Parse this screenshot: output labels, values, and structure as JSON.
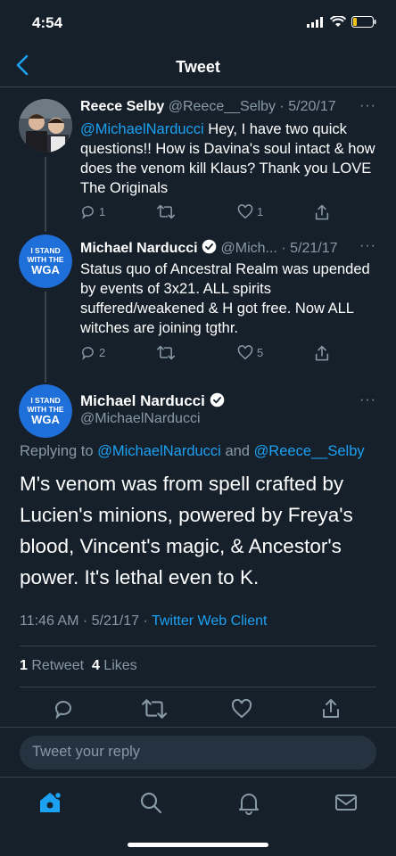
{
  "status_bar": {
    "time": "4:54"
  },
  "nav": {
    "title": "Tweet"
  },
  "tweets": [
    {
      "name": "Reece Selby",
      "handle": "@Reece__Selby",
      "date": "· 5/20/17",
      "mention": "@MichaelNarducci",
      "text": " Hey, I have two quick questions!! How is Davina's soul intact & how does the venom kill Klaus? Thank you LOVE The Originals",
      "reply_count": "1",
      "retweet_count": "",
      "like_count": "1"
    },
    {
      "name": "Michael Narducci",
      "handle": "@Mich...",
      "date": "· 5/21/17",
      "text": "Status quo of Ancestral Realm was upended by events of 3x21. ALL spirits suffered/weakened & H got free. Now ALL witches are joining tgthr.",
      "reply_count": "2",
      "retweet_count": "",
      "like_count": "5"
    }
  ],
  "avatar_badge": {
    "line1": "I STAND",
    "line2": "WITH THE",
    "line3": "WGA"
  },
  "main_tweet": {
    "name": "Michael Narducci",
    "handle": "@MichaelNarducci",
    "replying_prefix": "Replying to ",
    "replying_user1": "@MichaelNarducci",
    "replying_and": " and ",
    "replying_user2": "@Reece__Selby",
    "text": "M's venom was from spell crafted by Lucien's minions, powered by Freya's blood, Vincent's magic, & Ancestor's power. It's lethal even to K.",
    "time": "11:46 AM · 5/21/17 · ",
    "client": "Twitter Web Client",
    "retweets": "1",
    "retweets_label": " Retweet  ",
    "likes": "4",
    "likes_label": " Likes"
  },
  "reply_box": {
    "placeholder": "Tweet your reply"
  },
  "colors": {
    "background": "#15202b",
    "accent": "#1da1f2",
    "muted": "#8899a6",
    "divider": "#38444d"
  }
}
